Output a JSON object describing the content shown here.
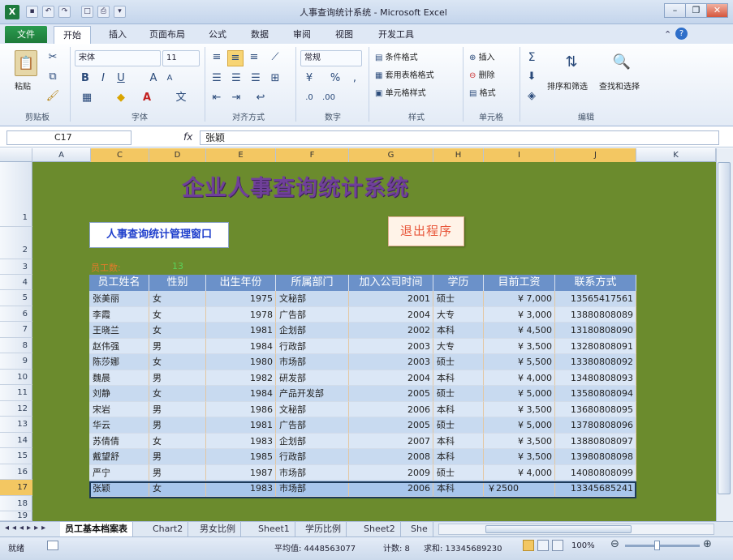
{
  "window": {
    "title": "人事查询统计系统 - Microsoft Excel",
    "app_icon": "X"
  },
  "quick_access": {
    "save": "▪",
    "undo": "↶",
    "redo": "↷",
    "new": "□",
    "print": "⎙",
    "more": "▾"
  },
  "window_controls": {
    "minimize": "–",
    "restore": "❐",
    "close": "✕"
  },
  "ribbon": {
    "file_tab": "文件",
    "tabs": [
      "开始",
      "插入",
      "页面布局",
      "公式",
      "数据",
      "审阅",
      "视图",
      "开发工具"
    ],
    "groups": {
      "clipboard": {
        "label": "剪贴板",
        "paste": "粘贴"
      },
      "font": {
        "label": "字体",
        "name": "宋体",
        "size": "11"
      },
      "alignment": {
        "label": "对齐方式"
      },
      "number": {
        "label": "数字",
        "format": "常规"
      },
      "styles": {
        "label": "样式",
        "items": [
          "条件格式",
          "套用表格格式",
          "单元格样式"
        ]
      },
      "cells": {
        "label": "单元格",
        "items": [
          "插入",
          "删除",
          "格式"
        ]
      },
      "editing": {
        "label": "编辑",
        "sort": "排序和筛选",
        "find": "查找和选择"
      }
    }
  },
  "formula_bar": {
    "name_box": "C17",
    "fx": "fx",
    "value": "张颖"
  },
  "columns": [
    "A",
    "C",
    "D",
    "E",
    "F",
    "G",
    "H",
    "I",
    "J",
    "K"
  ],
  "rows": [
    "1",
    "2",
    "3",
    "4",
    "5",
    "6",
    "7",
    "8",
    "9",
    "10",
    "11",
    "12",
    "13",
    "14",
    "15",
    "16",
    "17",
    "18",
    "19"
  ],
  "sheet": {
    "title": "企业人事查询统计系统",
    "window_label": "人事查询统计管理窗口",
    "exit_button": "退出程序",
    "count_label": "员工数:",
    "count_value": "13",
    "headers": [
      "员工姓名",
      "性别",
      "出生年份",
      "所属部门",
      "加入公司时间",
      "学历",
      "目前工资",
      "联系方式"
    ],
    "records": [
      [
        "张美丽",
        "女",
        "1975",
        "文秘部",
        "2001",
        "硕士",
        "¥   7,000",
        "13565417561"
      ],
      [
        "李霞",
        "女",
        "1978",
        "广告部",
        "2004",
        "大专",
        "¥   3,000",
        "13880808089"
      ],
      [
        "王晓兰",
        "女",
        "1981",
        "企划部",
        "2002",
        "本科",
        "¥   4,500",
        "13180808090"
      ],
      [
        "赵伟强",
        "男",
        "1984",
        "行政部",
        "2003",
        "大专",
        "¥   3,500",
        "13280808091"
      ],
      [
        "陈莎娜",
        "女",
        "1980",
        "市场部",
        "2003",
        "硕士",
        "¥   5,500",
        "13380808092"
      ],
      [
        "魏晨",
        "男",
        "1982",
        "研发部",
        "2004",
        "本科",
        "¥   4,000",
        "13480808093"
      ],
      [
        "刘静",
        "女",
        "1984",
        "产品开发部",
        "2005",
        "硕士",
        "¥   5,000",
        "13580808094"
      ],
      [
        "宋岩",
        "男",
        "1986",
        "文秘部",
        "2006",
        "本科",
        "¥   3,500",
        "13680808095"
      ],
      [
        "华云",
        "男",
        "1981",
        "广告部",
        "2005",
        "硕士",
        "¥   5,000",
        "13780808096"
      ],
      [
        "苏倩倩",
        "女",
        "1983",
        "企划部",
        "2007",
        "本科",
        "¥   3,500",
        "13880808097"
      ],
      [
        "戴望舒",
        "男",
        "1985",
        "行政部",
        "2008",
        "本科",
        "¥   3,500",
        "13980808098"
      ],
      [
        "严宁",
        "男",
        "1987",
        "市场部",
        "2009",
        "硕士",
        "¥   4,000",
        "14080808099"
      ],
      [
        "张颖",
        "女",
        "1983",
        "市场部",
        "2006",
        "本科",
        "￥2500",
        "13345685241"
      ]
    ]
  },
  "sheet_tabs": [
    "员工基本档案表",
    "Chart2",
    "男女比例",
    "Sheet1",
    "学历比例",
    "Sheet2",
    "She"
  ],
  "status": {
    "mode": "就绪",
    "average": "平均值: 4448563077",
    "count": "计数: 8",
    "sum": "求和: 13345689230",
    "zoom": "100%"
  },
  "colors": {
    "grid_background": "#6b8b2d",
    "title": "#70409a",
    "header": "#6b91c9",
    "file_tab": "#1e7a3a"
  }
}
